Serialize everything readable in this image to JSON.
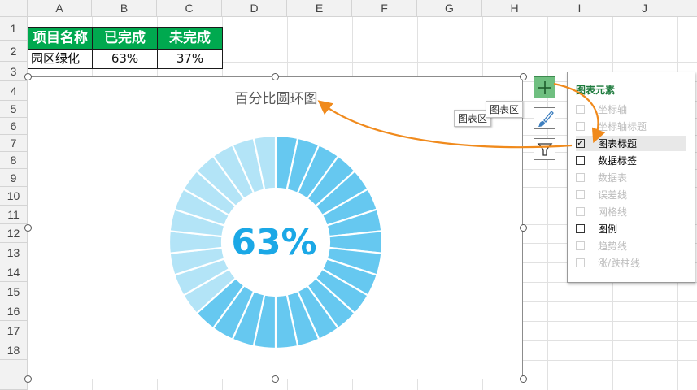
{
  "columns": [
    "A",
    "B",
    "C",
    "D",
    "E",
    "F",
    "G",
    "H",
    "I",
    "J"
  ],
  "rows": [
    "1",
    "2",
    "3",
    "4",
    "5",
    "6",
    "7",
    "8",
    "9",
    "10",
    "11",
    "12",
    "13",
    "14",
    "15",
    "16",
    "17",
    "18"
  ],
  "table": {
    "headers": [
      "项目名称",
      "已完成",
      "未完成"
    ],
    "row": [
      "园区绿化",
      "63%",
      "37%"
    ]
  },
  "chart": {
    "title": "百分比圆环图",
    "center_label": "63%",
    "tooltip_label": "图表区",
    "tooltip_label_2": "图表区"
  },
  "chart_data": {
    "type": "pie",
    "subtype": "doughnut",
    "title": "百分比圆环图",
    "categories": [
      "已完成",
      "未完成"
    ],
    "values": [
      63,
      37
    ],
    "segments_total": 30,
    "colors": {
      "completed": "#66c8f0",
      "remaining": "#b3e4f7",
      "center_text": "#1ba8e6"
    },
    "legend": "none"
  },
  "side_buttons": [
    {
      "name": "chart-elements",
      "icon": "plus-icon"
    },
    {
      "name": "chart-styles",
      "icon": "brush-icon"
    },
    {
      "name": "chart-filters",
      "icon": "funnel-icon"
    }
  ],
  "panel": {
    "title": "图表元素",
    "options": [
      {
        "label": "坐标轴",
        "checked": false,
        "enabled": false
      },
      {
        "label": "坐标轴标题",
        "checked": false,
        "enabled": false
      },
      {
        "label": "图表标题",
        "checked": true,
        "enabled": true
      },
      {
        "label": "数据标签",
        "checked": false,
        "enabled": true
      },
      {
        "label": "数据表",
        "checked": false,
        "enabled": false
      },
      {
        "label": "误差线",
        "checked": false,
        "enabled": false
      },
      {
        "label": "网格线",
        "checked": false,
        "enabled": false
      },
      {
        "label": "图例",
        "checked": false,
        "enabled": true
      },
      {
        "label": "趋势线",
        "checked": false,
        "enabled": false
      },
      {
        "label": "涨/跌柱线",
        "checked": false,
        "enabled": false
      }
    ]
  },
  "accent": "#f08a1c"
}
